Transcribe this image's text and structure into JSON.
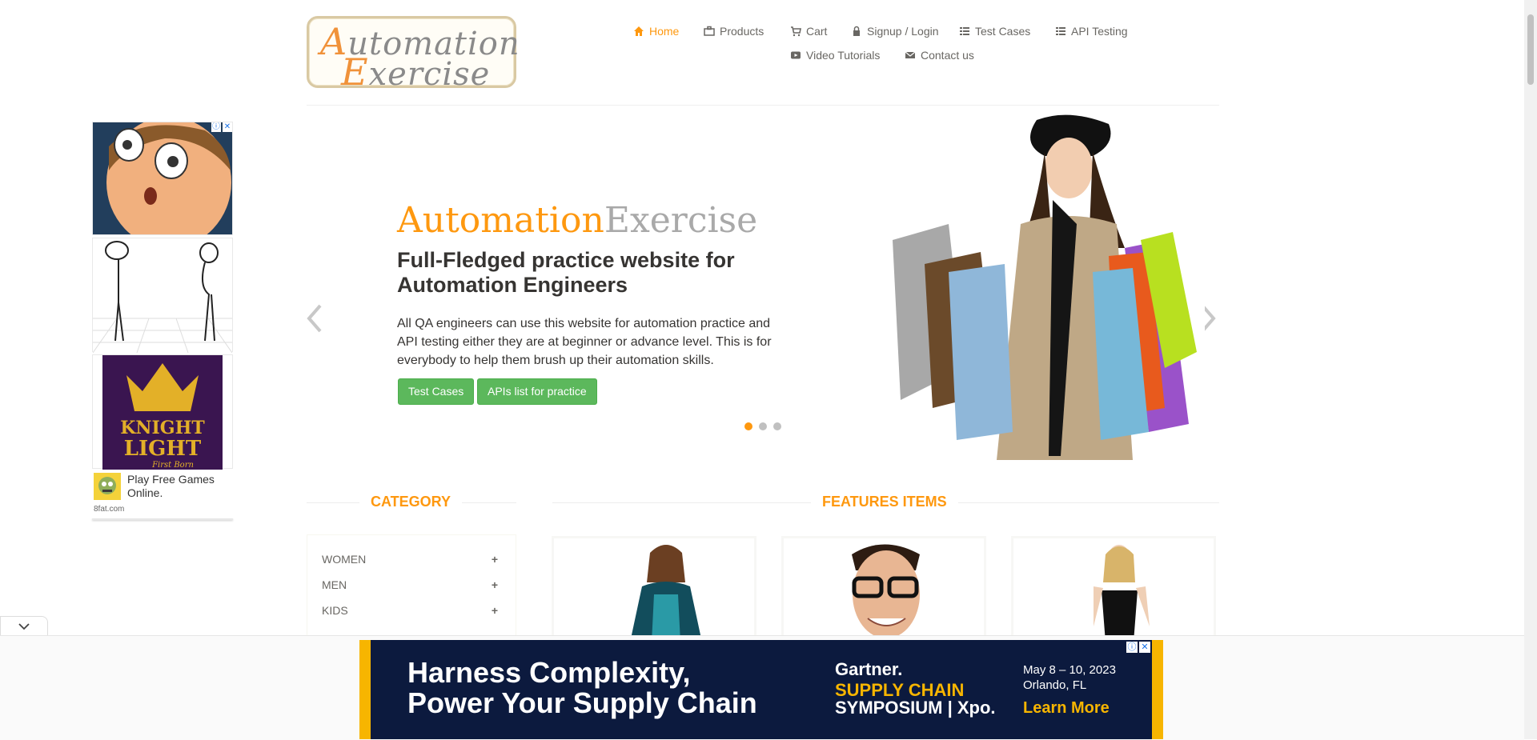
{
  "logo": {
    "line1_cap": "A",
    "line1_rest": "utomation",
    "line2_cap": "E",
    "line2_rest": "xercise"
  },
  "nav": [
    {
      "label": "Home",
      "icon": "home-icon",
      "active": true
    },
    {
      "label": "Products",
      "icon": "briefcase-icon"
    },
    {
      "label": "Cart",
      "icon": "cart-icon"
    },
    {
      "label": "Signup / Login",
      "icon": "lock-icon"
    },
    {
      "label": "Test Cases",
      "icon": "list-icon"
    },
    {
      "label": "API Testing",
      "icon": "list-icon"
    },
    {
      "label": "Video Tutorials",
      "icon": "youtube-icon"
    },
    {
      "label": "Contact us",
      "icon": "envelope-icon"
    }
  ],
  "side_ad": {
    "play_text": "Play Free Games Online.",
    "domain": "8fat.com",
    "poster_title_1": "KNIGHT",
    "poster_title_2": "LIGHT",
    "poster_sub": "First Born"
  },
  "slider": {
    "brand_a": "Automation",
    "brand_b": "Exercise",
    "heading": "Full-Fledged practice website for Automation Engineers",
    "paragraph": "All QA engineers can use this website for automation practice and API testing either they are at beginner or advance level. This is for everybody to help them brush up their automation skills.",
    "btn_test_cases": "Test Cases",
    "btn_apis": "APIs list for practice",
    "active_dot": 0,
    "dot_count": 3
  },
  "category": {
    "title": "CATEGORY",
    "items": [
      {
        "label": "WOMEN",
        "toggle": "+"
      },
      {
        "label": "MEN",
        "toggle": "+"
      },
      {
        "label": "KIDS",
        "toggle": "+"
      }
    ]
  },
  "features": {
    "title": "FEATURES ITEMS"
  },
  "bottom_ad": {
    "headline_1": "Harness Complexity,",
    "headline_2": "Power Your Supply Chain",
    "brand": "Gartner.",
    "event_1": "SUPPLY CHAIN",
    "event_2": "SYMPOSIUM | Xpo.",
    "date_1": "May 8 – 10, 2023",
    "date_2": "Orlando, FL",
    "cta": "Learn More"
  },
  "colors": {
    "accent": "#fe980f",
    "green": "#5cb85c",
    "text": "#696763",
    "banner_bg": "#0c1a3e",
    "banner_yellow": "#f7b500"
  }
}
